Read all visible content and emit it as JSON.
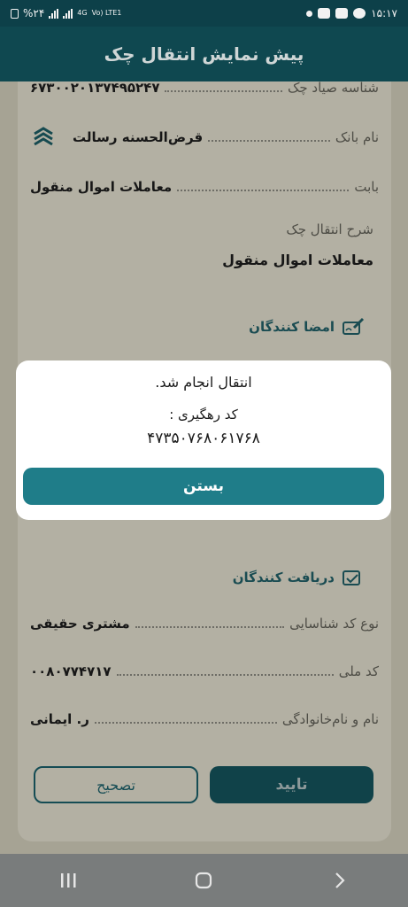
{
  "status_bar": {
    "time": "۱۵:۱۷",
    "battery": "%۲۴",
    "network": "4G",
    "lte": "Vo) LTE1"
  },
  "app_bar": {
    "title": "پیش نمایش انتقال چک"
  },
  "details": {
    "sayad_label": "شناسه صیاد چک",
    "sayad_value": "۶۷۳۰۰۲۰۱۳۷۴۹۵۲۴۷",
    "bank_label": "نام بانک",
    "bank_value": "قرض‌الحسنه رسالت",
    "reason_label": "بابت",
    "reason_value": "معاملات اموال منقول",
    "description_label": "شرح انتقال چک",
    "description_value": "معاملات اموال منقول"
  },
  "signers_section": {
    "title": "امضا کنندگان"
  },
  "receivers_section": {
    "title": "دریافت کنندگان",
    "id_type_label": "نوع کد شناسایی",
    "id_type_value": "مشتری حقیقی",
    "national_id_label": "کد ملی",
    "national_id_value": "۰۰۸۰۷۷۴۷۱۷",
    "name_label": "نام و نام‌خانوادگی",
    "name_value": "ر. ایمانی"
  },
  "actions": {
    "confirm_label": "تایید",
    "edit_label": "تصحیح"
  },
  "dialog": {
    "title": "انتقال انجام شد.",
    "tracking_label": "کد رهگیری :",
    "tracking_code": "۴۷۳۵۰۷۶۸۰۶۱۷۶۸",
    "close_label": "بستن"
  },
  "colors": {
    "primary": "#0f4850",
    "accent": "#1f7d89",
    "dialog_bg": "#ffffff"
  },
  "icons": [
    "bank-logo-icon",
    "signature-icon",
    "receivers-icon",
    "recent-apps-icon",
    "home-icon",
    "back-icon"
  ]
}
